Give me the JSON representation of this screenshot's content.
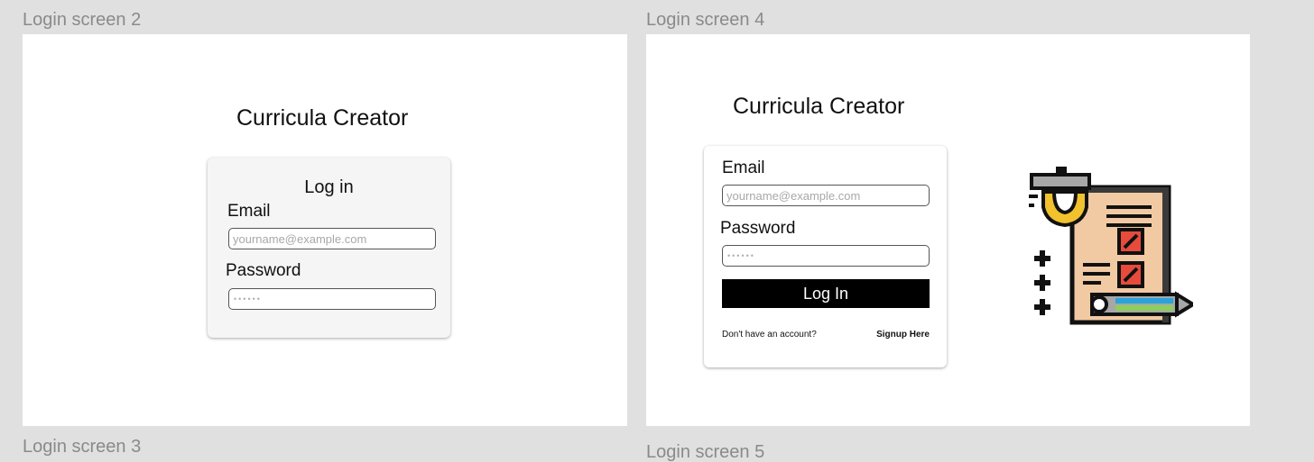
{
  "frames": {
    "login_screen_2": {
      "label": "Login screen 2",
      "app_title": "Curricula Creator",
      "card_heading": "Log in",
      "email_label": "Email",
      "email_placeholder": "yourname@example.com",
      "password_label": "Password",
      "password_placeholder": "••••••"
    },
    "login_screen_4": {
      "label": "Login screen 4",
      "app_title": "Curricula Creator",
      "email_label": "Email",
      "email_placeholder": "yourname@example.com",
      "password_label": "Password",
      "password_placeholder": "••••••",
      "login_button_label": "Log In",
      "no_account_text": "Don't have an account?",
      "signup_link_label": "Signup Here",
      "illustration_icon": "curriculum-creator-icon"
    },
    "login_screen_3": {
      "label": "Login screen 3"
    },
    "login_screen_5": {
      "label": "Login screen 5"
    }
  },
  "colors": {
    "canvas": "#e0e0e0",
    "frame_bg": "#ffffff",
    "card_bg_screen2": "#f5f5f5",
    "button_bg": "#000000",
    "frame_label": "#8a8a8a"
  }
}
